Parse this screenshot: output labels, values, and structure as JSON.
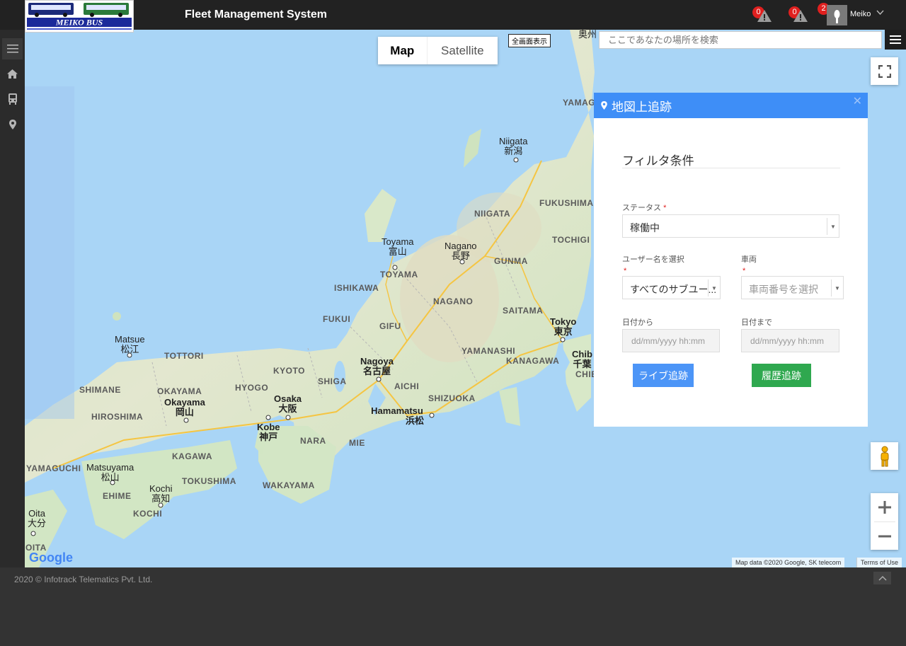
{
  "header": {
    "logo_text": "MEIKO BUS",
    "app_title": "Fleet Management System",
    "alerts": [
      {
        "icon": "warning-icon",
        "count": "0"
      },
      {
        "icon": "warning-icon",
        "count": "0"
      }
    ],
    "user_notifications": "2",
    "username": "Meiko"
  },
  "sidebar": {
    "items": [
      {
        "icon": "menu-icon"
      },
      {
        "icon": "home-icon"
      },
      {
        "icon": "bus-icon"
      },
      {
        "icon": "map-marker-icon"
      }
    ]
  },
  "map": {
    "type_map": "Map",
    "type_satellite": "Satellite",
    "fullscreen_text": "全画面表示",
    "search_placeholder": "ここであなたの場所を検索",
    "attribution": "Map data ©2020 Google, SK telecom",
    "terms": "Terms of Use",
    "google_logo": "Google",
    "labels": {
      "niigata_en": "Niigata",
      "niigata_ja": "新潟",
      "toyama_en": "Toyama",
      "toyama_ja": "富山",
      "nagano_en": "Nagano",
      "nagano_ja": "長野",
      "tokyo_en": "Tokyo",
      "tokyo_ja": "東京",
      "chiba_en": "Chib",
      "chiba_ja": "千葉",
      "nagoya_en": "Nagoya",
      "nagoya_ja": "名古屋",
      "osaka_en": "Osaka",
      "osaka_ja": "大阪",
      "kobe_en": "Kobe",
      "kobe_ja": "神戸",
      "okayama_en": "Okayama",
      "okayama_ja": "岡山",
      "hamamatsu_en": "Hamamatsu",
      "hamamatsu_ja": "浜松",
      "matsue_en": "Matsue",
      "matsue_ja": "松江",
      "matsuyama_en": "Matsuyama",
      "matsuyama_ja": "松山",
      "kochi_en": "Kochi",
      "kochi_ja": "高知",
      "oita_en": "Oita",
      "oita_ja": "大分",
      "oku_ja": "奥州",
      "yamagata": "YAMAG",
      "fukushima": "FUKUSHIMA",
      "niigata_pref": "NIIGATA",
      "tochigi": "TOCHIGI",
      "gunma": "GUNMA",
      "toyama_pref": "TOYAMA",
      "ishikawa": "ISHIKAWA",
      "nagano_pref": "NAGANO",
      "saitama": "SAITAMA",
      "fukui": "FUKUI",
      "gifu": "GIFU",
      "yamanashi": "YAMANASHI",
      "kanagawa": "KANAGAWA",
      "tottori": "TOTTORI",
      "kyoto": "KYOTO",
      "hyogo": "HYOGO",
      "shiga": "SHIGA",
      "aichi": "AICHI",
      "shizuoka": "SHIZUOKA",
      "shimane": "SHIMANE",
      "okayama_pref": "OKAYAMA",
      "hiroshima": "HIROSHIMA",
      "nara": "NARA",
      "mie": "MIE",
      "kagawa": "KAGAWA",
      "yamaguchi": "YAMAGUCHI",
      "tokushima": "TOKUSHIMA",
      "ehime": "EHIME",
      "kochi_pref": "KOCHI",
      "wakayama": "WAKAYAMA",
      "oita_pref": "OITA",
      "chiba_pref": "CHIB"
    }
  },
  "panel": {
    "title": "地図上追跡",
    "filter_title": "フィルタ条件",
    "status_label": "ステータス",
    "status_value": "稼働中",
    "user_label": "ユーザー名を選択",
    "user_value": "すべてのサブユー...",
    "vehicle_label": "車両",
    "vehicle_placeholder": "車両番号を選択",
    "date_from_label": "日付から",
    "date_from_placeholder": "dd/mm/yyyy hh:mm",
    "date_to_label": "日付まで",
    "date_to_placeholder": "dd/mm/yyyy hh:mm",
    "live_button": "ライブ追跡",
    "history_button": "履歴追跡",
    "required_mark": "*",
    "accent_color": "#3e8ef7",
    "history_color": "#2fa84f"
  },
  "footer": {
    "copyright": "2020 © Infotrack Telematics Pvt. Ltd."
  }
}
